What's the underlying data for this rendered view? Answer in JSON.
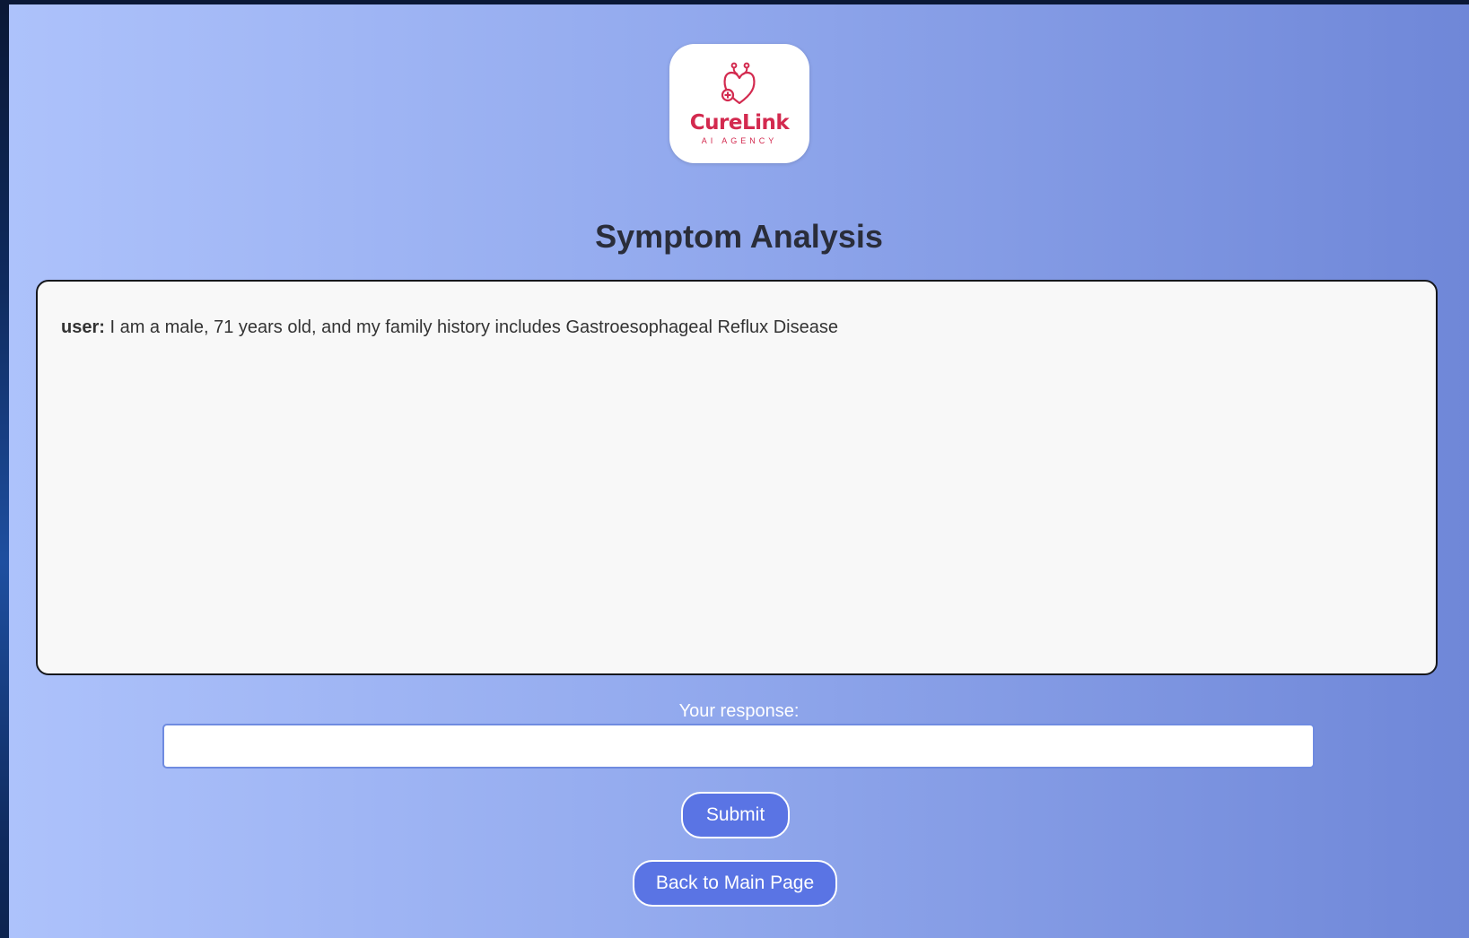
{
  "logo": {
    "icon": "stethoscope-heart-icon",
    "brand_name": "CureLink",
    "tagline": "AI AGENCY",
    "brand_color": "#d32a4f"
  },
  "page": {
    "title": "Symptom Analysis"
  },
  "chat": {
    "messages": [
      {
        "sender": "user:",
        "text": "I am a male, 71 years old, and my family history includes Gastroesophageal Reflux Disease"
      }
    ]
  },
  "response": {
    "label": "Your response:",
    "value": "",
    "placeholder": ""
  },
  "buttons": {
    "submit_label": "Submit",
    "back_label": "Back to Main Page",
    "accent_color": "#5a74e4"
  }
}
